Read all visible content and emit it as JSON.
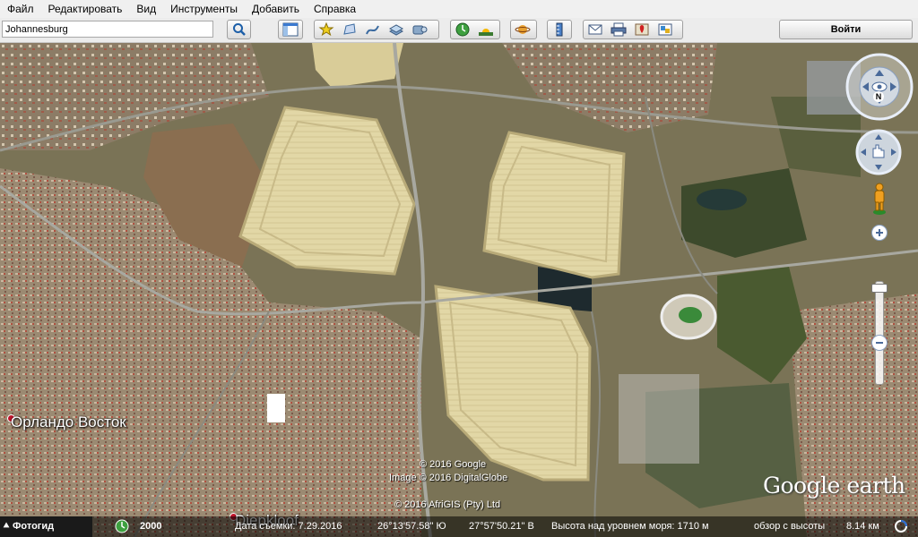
{
  "menu": {
    "items": [
      "Файл",
      "Редактировать",
      "Вид",
      "Инструменты",
      "Добавить",
      "Справка"
    ]
  },
  "toolbar": {
    "search_value": "Johannesburg",
    "login_label": "Войти",
    "icons": [
      "sidebar-icon",
      "placemark-icon",
      "polygon-icon",
      "path-icon",
      "image-overlay-icon",
      "tour-icon",
      "historical-imagery-icon",
      "sunlight-icon",
      "planets-icon",
      "ruler-icon",
      "email-icon",
      "print-icon",
      "google-maps-icon",
      "save-image-icon"
    ]
  },
  "map": {
    "place_labels": [
      {
        "name": "Орландо Восток"
      },
      {
        "name": "Diepkloof"
      }
    ],
    "credits": [
      "© 2016 Google",
      "Image © 2016 DigitalGlobe",
      "© 2016 AfriGIS (Pty) Ltd"
    ],
    "logo_a": "Google",
    "logo_b": " earth",
    "compass_north": "N"
  },
  "statusbar": {
    "photos_label": "Фотогид",
    "history_year": "2000",
    "capture_date": "Дата съемки: 7.29.2016",
    "latitude": "26°13'57.58\" Ю",
    "longitude": "27°57'50.21\" В",
    "elevation": "Высота над уровнем моря:  1710 м",
    "eye_alt": "обзор с высоты",
    "eye_alt_value": "8.14 км"
  },
  "colors": {
    "mine_dump": "#e2d7a6",
    "terrain": "#7a7356",
    "township": "#9b8a72",
    "vegetation": "#3d4a2c"
  }
}
